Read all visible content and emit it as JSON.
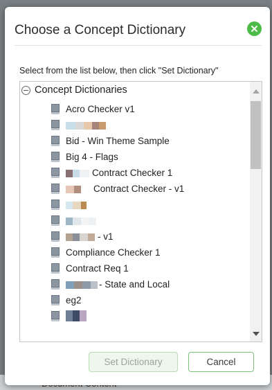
{
  "background": {
    "partial_label": "Document Content"
  },
  "dialog": {
    "title": "Choose a Concept Dictionary",
    "close_icon": "close-icon",
    "instruction": "Select from the list below, then click \"Set Dictionary\"",
    "tree": {
      "root_label": "Concept Dictionaries",
      "items": [
        {
          "label": "Acro Checker v1",
          "redacted": false
        },
        {
          "label": "",
          "redacted": true
        },
        {
          "label": "Bid - Win Theme Sample",
          "redacted": false
        },
        {
          "label": "Big 4 - Flags",
          "redacted": false
        },
        {
          "label": "Contract Checker 1",
          "redacted": true
        },
        {
          "label": "Contract Checker - v1",
          "redacted": true
        },
        {
          "label": "",
          "redacted": true
        },
        {
          "label": "",
          "redacted": true
        },
        {
          "label": "- v1",
          "redacted": true
        },
        {
          "label": "Compliance Checker 1",
          "redacted": false
        },
        {
          "label": "Contract Req 1",
          "redacted": false
        },
        {
          "label": "- State and Local",
          "redacted": true
        },
        {
          "label": "eg2",
          "redacted": false
        },
        {
          "label": "",
          "redacted": true
        }
      ]
    },
    "buttons": {
      "set_dictionary": "Set Dictionary",
      "cancel": "Cancel"
    },
    "colors": {
      "accent_green": "#4cbb47",
      "disabled_button_bg": "#eef6ee"
    }
  }
}
